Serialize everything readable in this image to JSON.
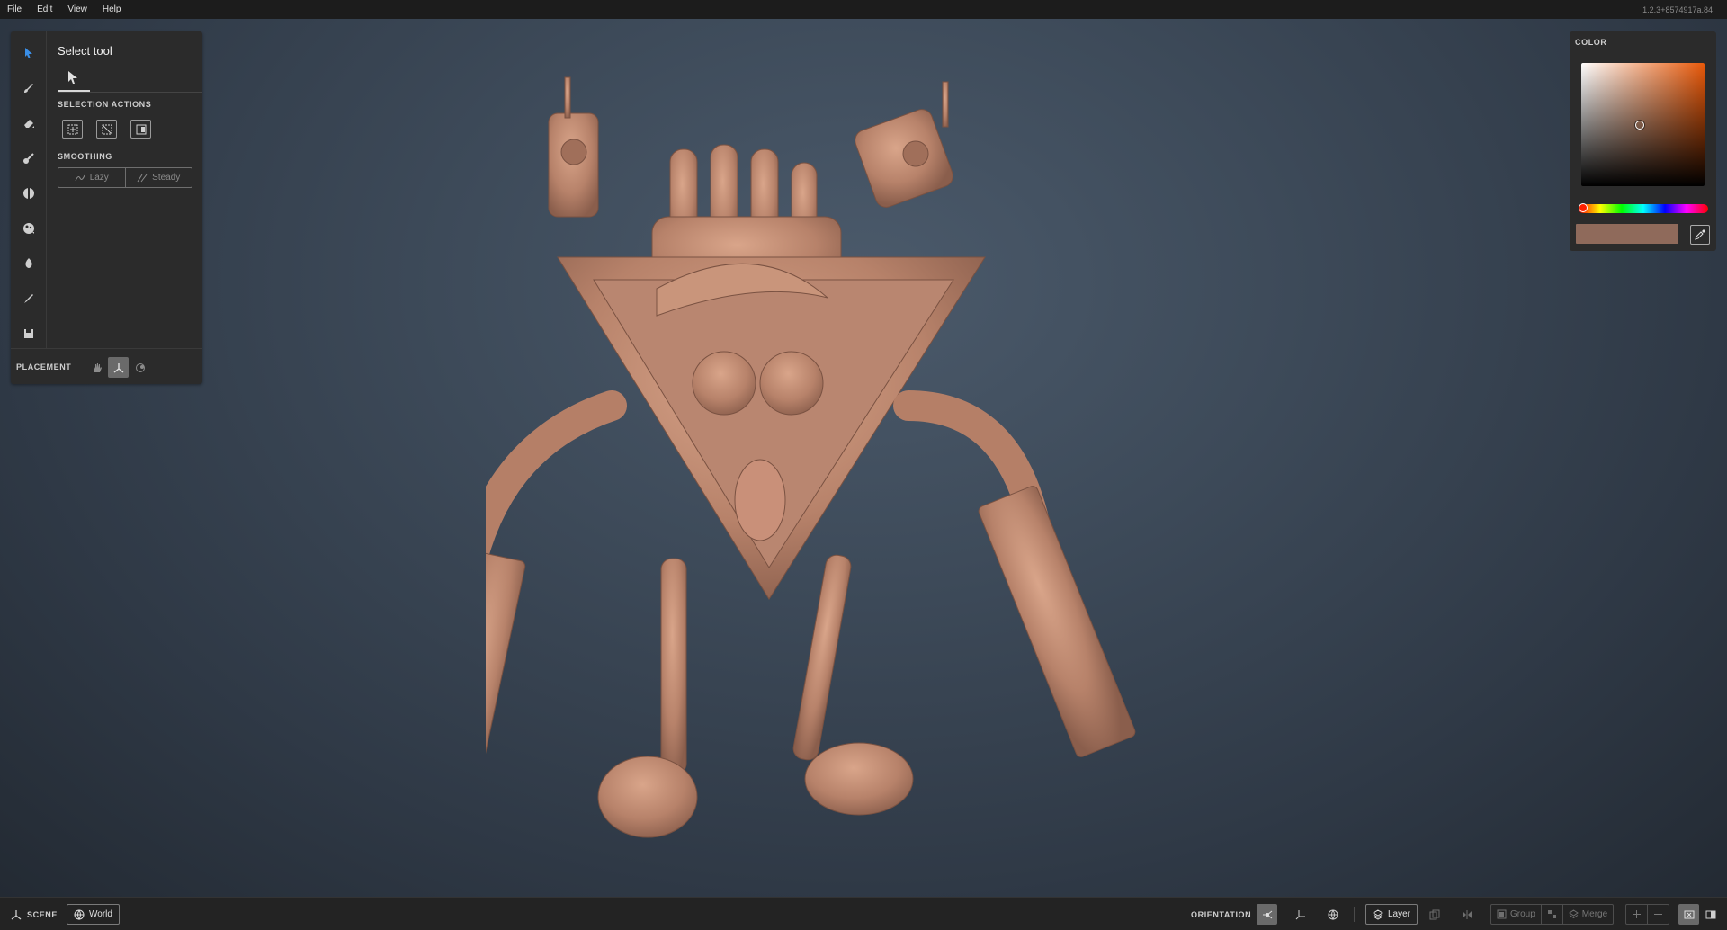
{
  "menu": {
    "items": [
      "File",
      "Edit",
      "View",
      "Help"
    ],
    "version": "1.2.3+8574917a.84"
  },
  "tool_panel": {
    "title": "Select tool",
    "selection_actions_label": "SELECTION ACTIONS",
    "smoothing_label": "SMOOTHING",
    "smoothing_options": [
      "Lazy",
      "Steady"
    ],
    "placement_label": "PLACEMENT",
    "tools": [
      "select-tool-icon",
      "brush-icon",
      "eraser-icon",
      "smudge-icon",
      "move-icon",
      "color-picker-icon",
      "fill-icon",
      "paint-icon",
      "save-icon"
    ]
  },
  "color_panel": {
    "label": "COLOR",
    "hue_color": "#e8590a",
    "current_color": "#8f6a5b"
  },
  "status_bar": {
    "scene_label": "SCENE",
    "world_label": "World",
    "orientation_label": "ORIENTATION",
    "layer_label": "Layer",
    "group_label": "Group",
    "merge_label": "Merge"
  },
  "colors": {
    "model": "#c08a70",
    "accent": "#3a8ee6"
  }
}
